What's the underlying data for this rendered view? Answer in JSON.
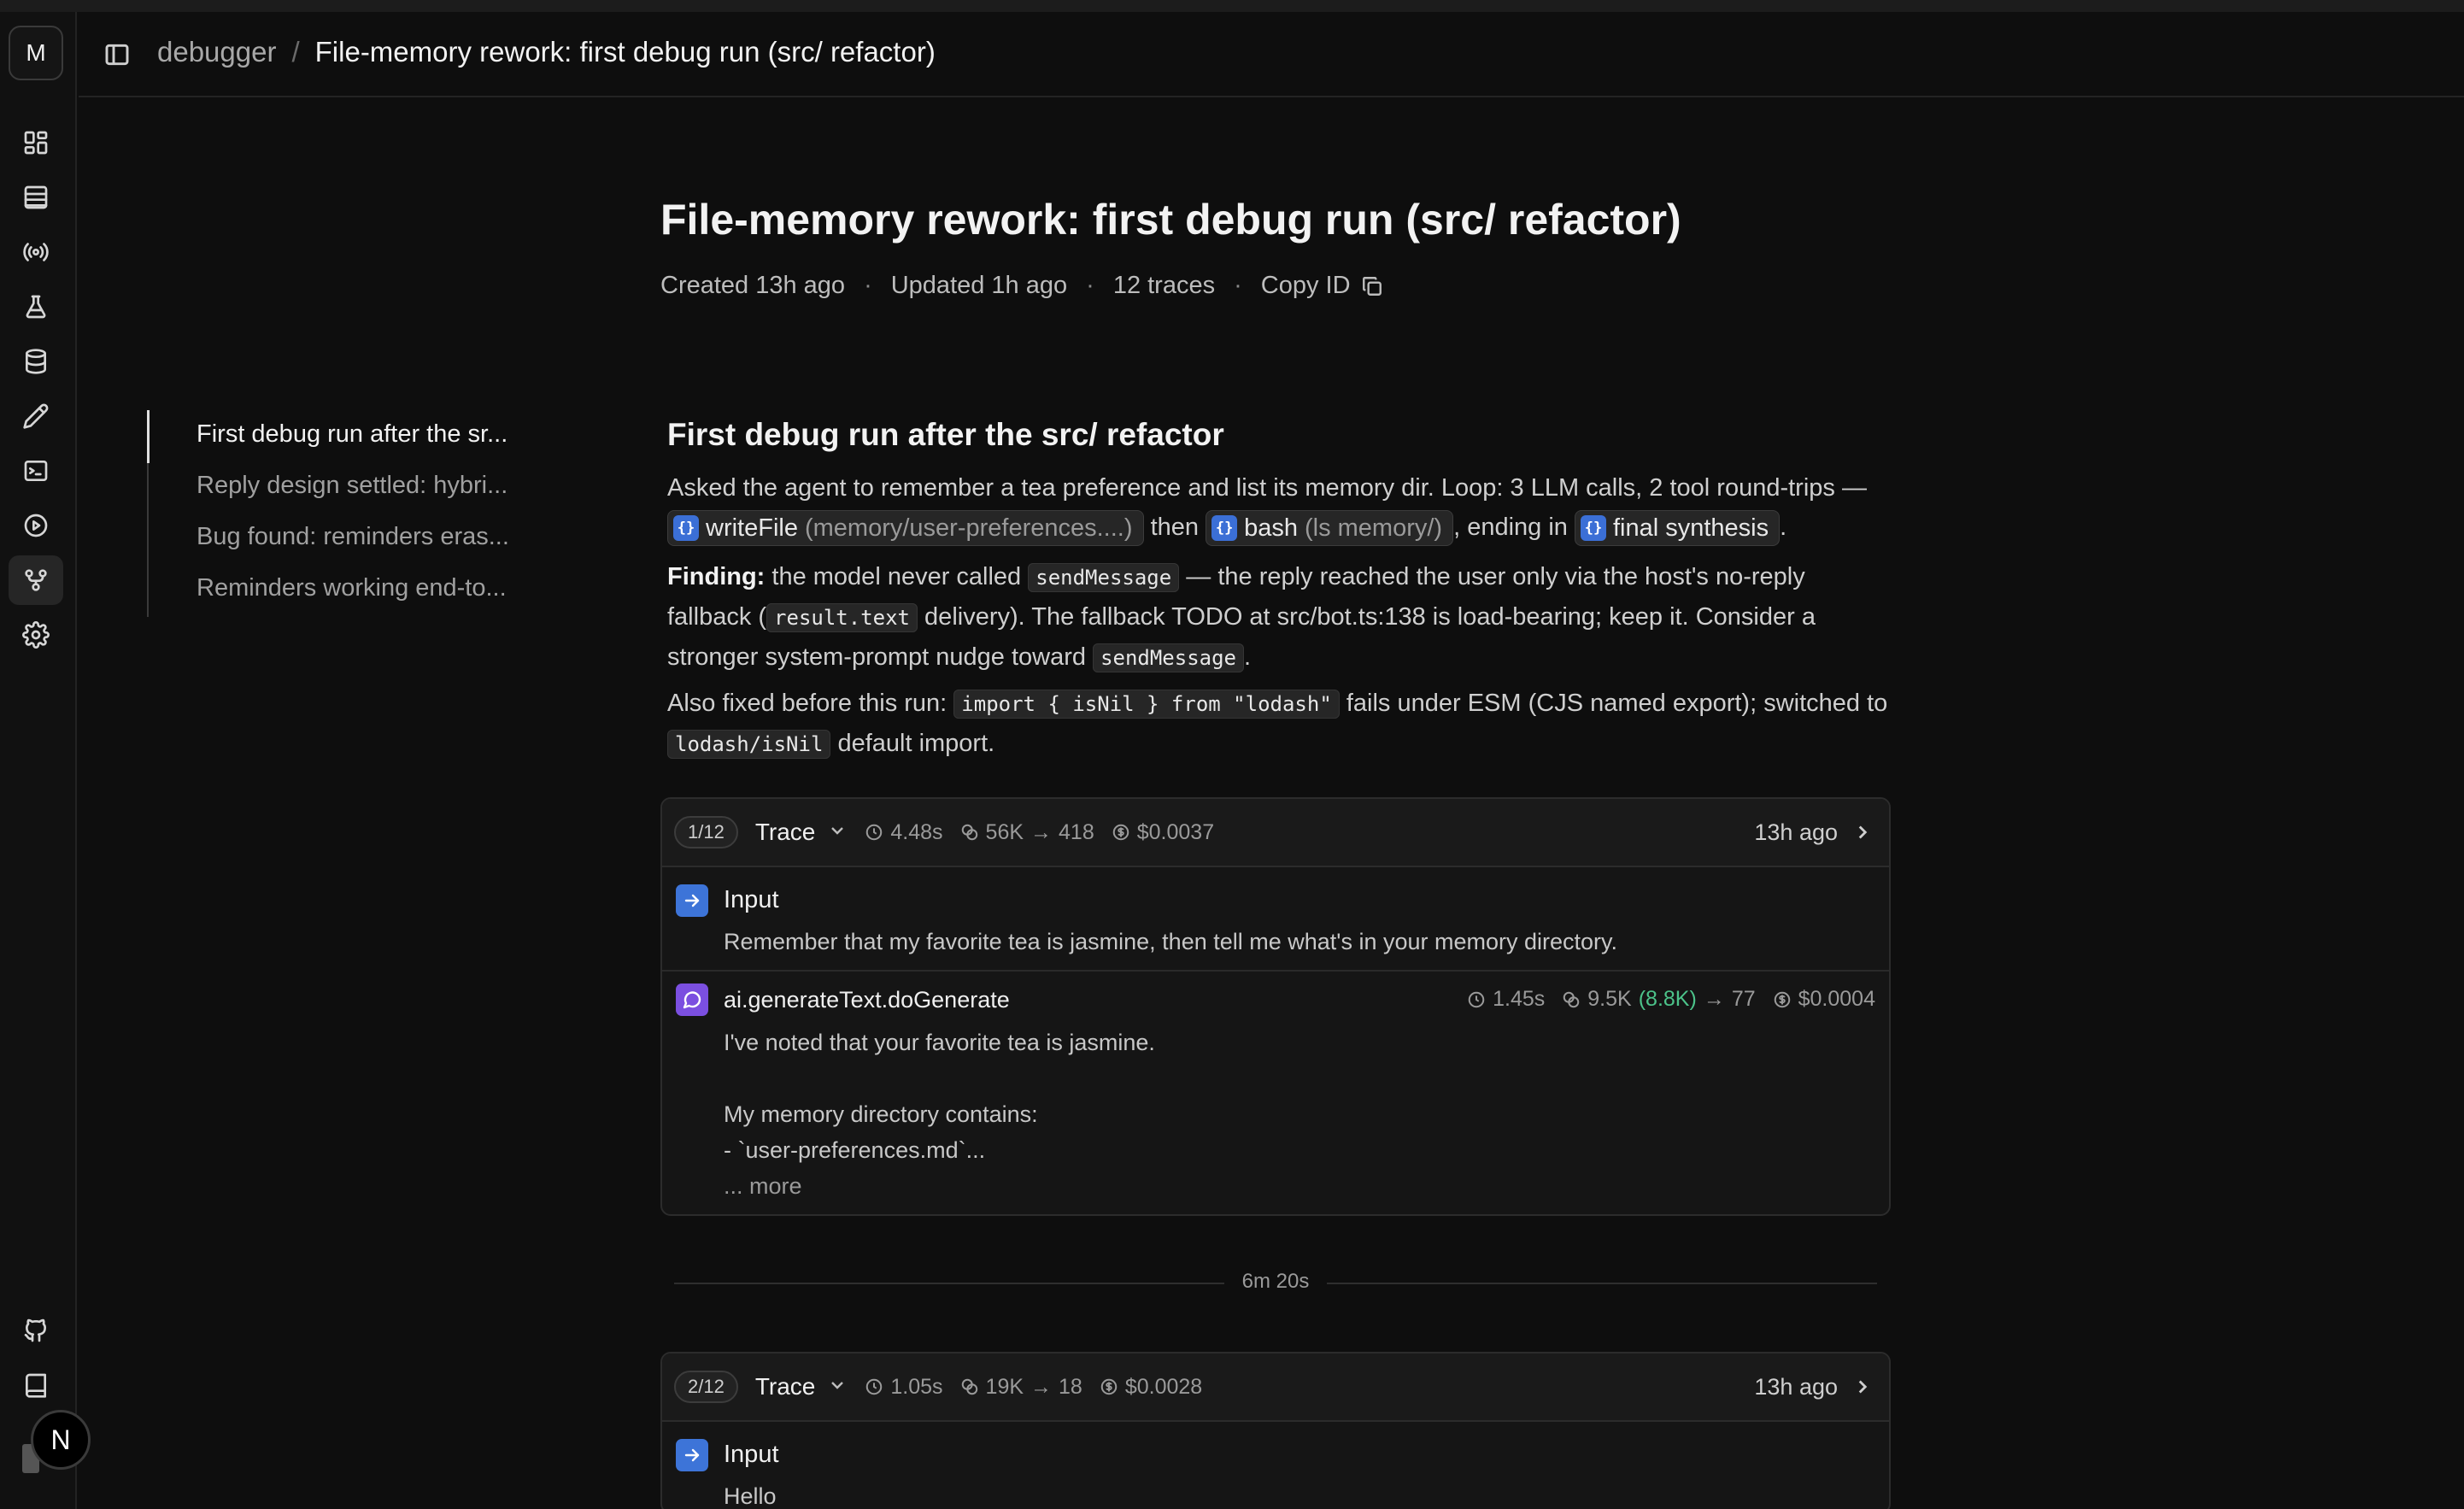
{
  "rail": {
    "avatar_letter": "M",
    "next_letter": "N",
    "icons": [
      "dashboard-icon",
      "table-icon",
      "broadcast-icon",
      "flask-icon",
      "database-icon",
      "pencil-icon",
      "terminal-icon",
      "play-icon",
      "git-fork-icon",
      "gear-icon",
      "github-icon",
      "book-icon"
    ]
  },
  "header": {
    "project": "debugger",
    "separator": "/",
    "current": "File-memory rework: first debug run (src/ refactor)"
  },
  "page": {
    "title": "File-memory rework: first debug run (src/ refactor)",
    "created": "Created 13h ago",
    "updated": "Updated 1h ago",
    "traces": "12 traces",
    "copy_id": "Copy ID",
    "dot": "·"
  },
  "toc": {
    "items": [
      "First debug run after the sr...",
      "Reply design settled: hybri...",
      "Bug found: reminders eras...",
      "Reminders working end-to..."
    ]
  },
  "section": {
    "title": "First debug run after the src/ refactor",
    "p1": {
      "text_a": "Asked the agent to remember a tea preference and list its memory dir. Loop: 3 LLM calls, 2 tool round-trips —",
      "chip1_name": "writeFile",
      "chip1_arg": "(memory/user-preferences....)",
      "then": "then",
      "chip2_name": "bash",
      "chip2_arg": "(ls memory/)",
      "ending": ", ending in",
      "chip3_name": "final synthesis",
      "end": "."
    },
    "p2": {
      "bold": "Finding:",
      "a": " the model never called ",
      "code1": "sendMessage",
      "b": " — the reply reached the user only via the host's no-reply fallback (",
      "code2": "result.text",
      "c": " delivery). The fallback TODO at src/bot.ts:138 is load-bearing; keep it. Consider a stronger system-prompt nudge toward ",
      "code3": "sendMessage",
      "d": "."
    },
    "p3": {
      "a": "Also fixed before this run: ",
      "code1": "import { isNil } from \"lodash\"",
      "b": " fails under ESM (CJS named export); switched to ",
      "code2": "lodash/isNil",
      "c": " default import."
    },
    "chip_badge": "{}"
  },
  "traces": [
    {
      "count": "1/12",
      "label": "Trace",
      "duration": "4.48s",
      "tokens_in": "56K",
      "tokens_out": "418",
      "cost": "$0.0037",
      "time": "13h ago",
      "input_title": "Input",
      "input_text": "Remember that my favorite tea is jasmine, then tell me what's in your memory directory.",
      "gen_title": "ai.generateText.doGenerate",
      "gen_duration": "1.45s",
      "gen_tokens_in": "9.5K",
      "gen_cached": "(8.8K)",
      "gen_tokens_out": "77",
      "gen_cost": "$0.0004",
      "gen_line1": "I've noted that your favorite tea is jasmine.",
      "gen_line2": "My memory directory contains:",
      "gen_line3": "- `user-preferences.md`...",
      "gen_more": "... more"
    },
    {
      "count": "2/12",
      "label": "Trace",
      "duration": "1.05s",
      "tokens_in": "19K",
      "tokens_out": "18",
      "cost": "$0.0028",
      "time": "13h ago",
      "input_title": "Input",
      "input_text": "Hello"
    }
  ],
  "gap_label": "6m 20s",
  "arrow": "→"
}
